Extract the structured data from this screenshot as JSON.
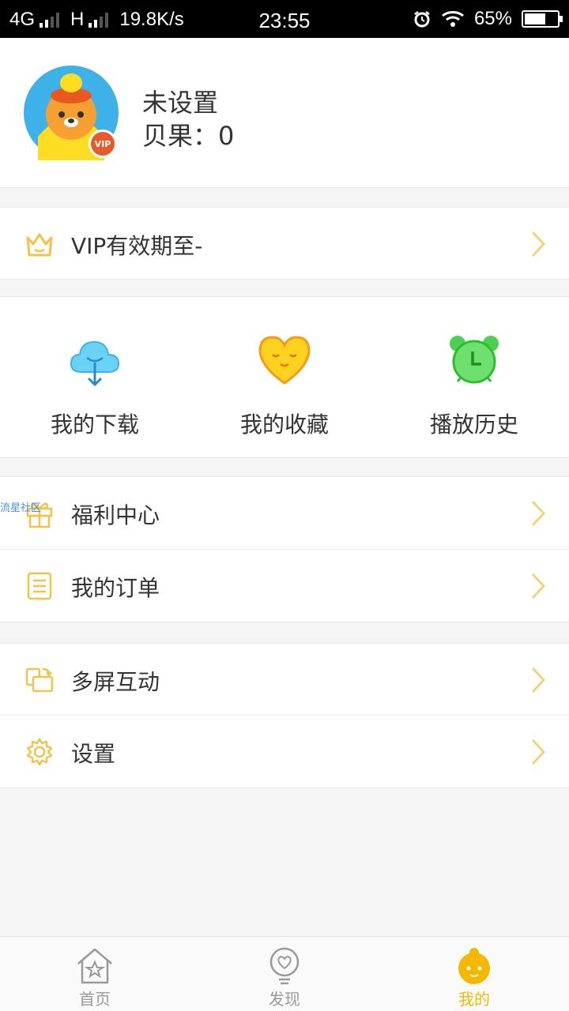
{
  "status_bar": {
    "network_1": "4G",
    "network_2": "H",
    "speed": "19.8K/s",
    "time": "23:55",
    "battery": "65%",
    "battery_level": 0.65
  },
  "profile": {
    "name": "未设置",
    "beans": "贝果：0",
    "badge": "VIP"
  },
  "vip_row": {
    "label": "VIP有效期至-"
  },
  "shortcuts": [
    {
      "label": "我的下载",
      "icon": "cloud-download-icon",
      "color": "#5ac8f0"
    },
    {
      "label": "我的收藏",
      "icon": "heart-icon",
      "color": "#ffcc00"
    },
    {
      "label": "播放历史",
      "icon": "alarm-clock-icon",
      "color": "#5dd35d"
    }
  ],
  "menu_group_1": [
    {
      "label": "福利中心",
      "icon": "gift-icon"
    },
    {
      "label": "我的订单",
      "icon": "order-list-icon"
    }
  ],
  "menu_group_2": [
    {
      "label": "多屏互动",
      "icon": "multi-screen-icon"
    },
    {
      "label": "设置",
      "icon": "gear-icon"
    }
  ],
  "watermark": "流星社区",
  "tabbar": [
    {
      "label": "首页",
      "icon": "home-icon",
      "active": false
    },
    {
      "label": "发现",
      "icon": "discover-icon",
      "active": false
    },
    {
      "label": "我的",
      "icon": "me-icon",
      "active": true
    }
  ],
  "colors": {
    "accent": "#f5b800",
    "icon_outline": "#f3c24a",
    "chevron": "#f5d27a"
  }
}
